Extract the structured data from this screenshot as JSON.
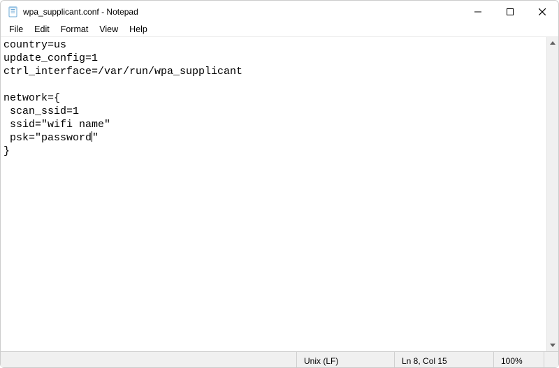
{
  "window": {
    "title": "wpa_supplicant.conf - Notepad"
  },
  "menu": {
    "file": "File",
    "edit": "Edit",
    "format": "Format",
    "view": "View",
    "help": "Help"
  },
  "editor": {
    "line1": "country=us",
    "line2": "update_config=1",
    "line3": "ctrl_interface=/var/run/wpa_supplicant",
    "line4": "",
    "line5": "network={",
    "line6": " scan_ssid=1",
    "line7": " ssid=\"wifi name\"",
    "line8_pre": " psk=\"password",
    "line8_post": "\"",
    "line9": "}"
  },
  "status": {
    "eol": "Unix (LF)",
    "position": "Ln 8, Col 15",
    "zoom": "100%"
  }
}
